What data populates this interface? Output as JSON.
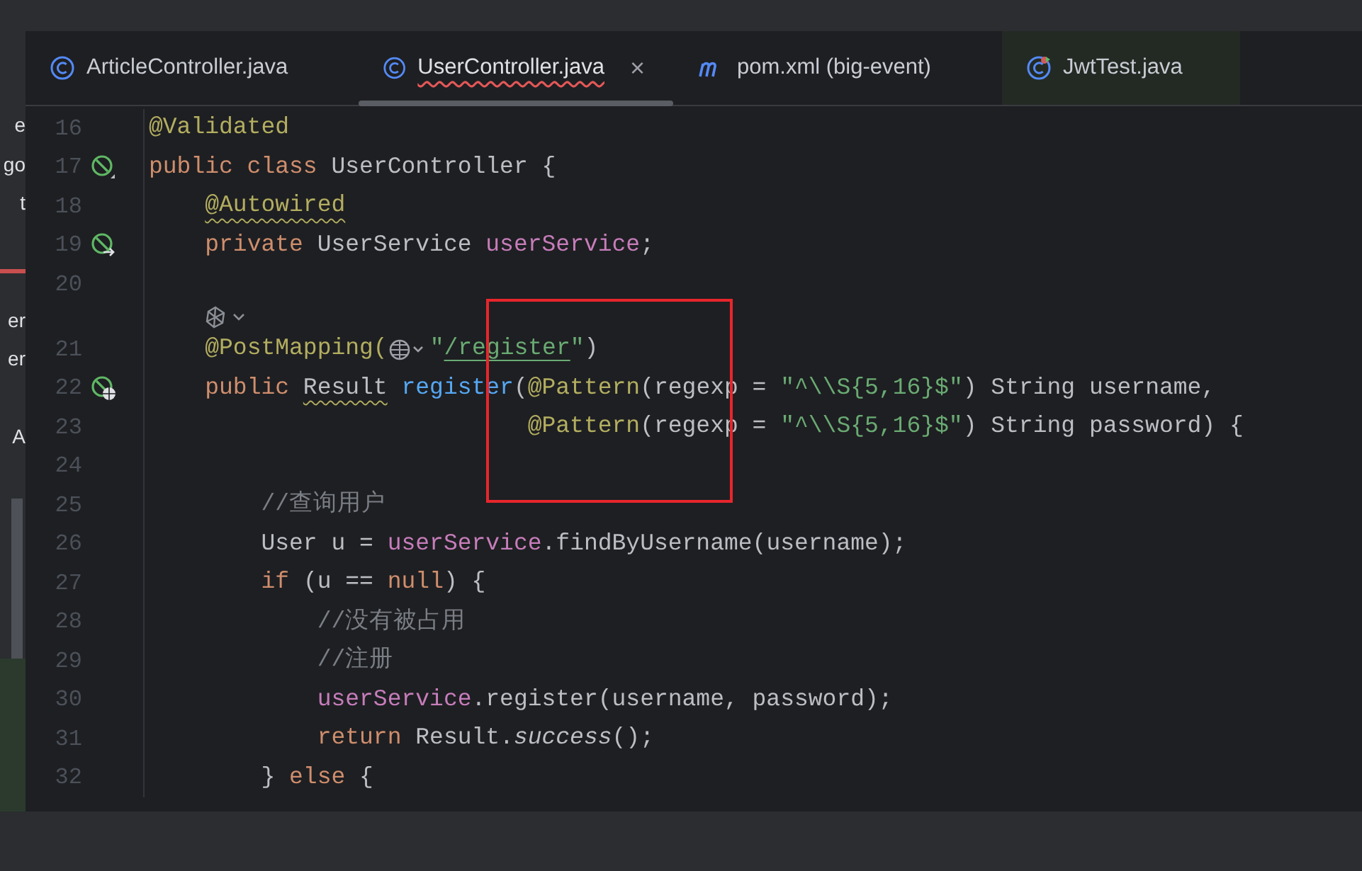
{
  "project_panel": {
    "fragments": [
      "e",
      "go",
      "t",
      "er",
      "er",
      "A"
    ]
  },
  "tabs": [
    {
      "label": "ArticleController.java",
      "kind": "class",
      "selected": false,
      "error": false
    },
    {
      "label": "UserController.java",
      "kind": "class",
      "selected": true,
      "error": true,
      "close": "×"
    },
    {
      "label": "pom.xml (big-event)",
      "kind": "maven",
      "selected": false,
      "error": false
    },
    {
      "label": "JwtTest.java",
      "kind": "test",
      "selected": false,
      "error": false,
      "color": "#232a24"
    }
  ],
  "editor": {
    "lines": [
      {
        "kind": "code",
        "number": "16",
        "tokens": [
          {
            "kind": "annotation",
            "s": "@Validated"
          }
        ]
      },
      {
        "kind": "code",
        "number": "17",
        "gutter": {
          "kind": "bean"
        },
        "tokens": [
          {
            "kind": "keyword",
            "s": "public class "
          },
          {
            "kind": "plain",
            "s": "UserController {"
          }
        ]
      },
      {
        "kind": "code",
        "number": "18",
        "tokens": [
          {
            "kind": "annotation",
            "s": "    @Autowired",
            "wavy": true
          }
        ]
      },
      {
        "kind": "code",
        "number": "19",
        "gutter": {
          "kind": "bean-arrow"
        },
        "tokens": [
          {
            "kind": "keyword",
            "s": "    private "
          },
          {
            "kind": "plain",
            "s": "UserService "
          },
          {
            "kind": "field",
            "s": "userService"
          },
          {
            "kind": "plain",
            "s": ";"
          }
        ]
      },
      {
        "kind": "code",
        "number": "20"
      },
      {
        "kind": "hint"
      },
      {
        "kind": "code",
        "number": "21",
        "tokens": [
          {
            "kind": "annotation",
            "s": "    @PostMapping("
          },
          {
            "kind": "globe"
          },
          {
            "kind": "string",
            "s": "\""
          },
          {
            "kind": "string",
            "s": "/register",
            "link": true
          },
          {
            "kind": "string",
            "s": "\""
          },
          {
            "kind": "plain",
            "s": ")"
          }
        ]
      },
      {
        "kind": "code",
        "number": "22",
        "gutter": {
          "kind": "bean-web"
        },
        "tokens": [
          {
            "kind": "keyword",
            "s": "    public "
          },
          {
            "kind": "plain",
            "s": "Result",
            "wavy": true
          },
          {
            "kind": "method",
            "s": " register"
          },
          {
            "kind": "plain",
            "s": "("
          },
          {
            "kind": "annotation",
            "s": "@Pattern"
          },
          {
            "kind": "plain",
            "s": "(regexp = "
          },
          {
            "kind": "string",
            "s": "\"^\\\\S{5,16}$\""
          },
          {
            "kind": "plain",
            "s": ") String username,"
          }
        ]
      },
      {
        "kind": "code",
        "number": "23",
        "tokens": [
          {
            "kind": "annotation",
            "s": "                           @Pattern"
          },
          {
            "kind": "plain",
            "s": "(regexp = "
          },
          {
            "kind": "string",
            "s": "\"^\\\\S{5,16}$\""
          },
          {
            "kind": "plain",
            "s": ") String password) {"
          }
        ]
      },
      {
        "kind": "code",
        "number": "24"
      },
      {
        "kind": "code",
        "number": "25",
        "tokens": [
          {
            "kind": "comment",
            "s": "        //查询用户"
          }
        ]
      },
      {
        "kind": "code",
        "number": "26",
        "tokens": [
          {
            "kind": "plain",
            "s": "        User u = "
          },
          {
            "kind": "field",
            "s": "userService"
          },
          {
            "kind": "plain",
            "s": ".findByUsername(username);"
          }
        ]
      },
      {
        "kind": "code",
        "number": "27",
        "tokens": [
          {
            "kind": "keyword",
            "s": "        if "
          },
          {
            "kind": "plain",
            "s": "(u == "
          },
          {
            "kind": "keyword",
            "s": "null"
          },
          {
            "kind": "plain",
            "s": ") {"
          }
        ]
      },
      {
        "kind": "code",
        "number": "28",
        "tokens": [
          {
            "kind": "comment",
            "s": "            //没有被占用"
          }
        ]
      },
      {
        "kind": "code",
        "number": "29",
        "tokens": [
          {
            "kind": "comment",
            "s": "            //注册"
          }
        ]
      },
      {
        "kind": "code",
        "number": "30",
        "tokens": [
          {
            "kind": "field",
            "s": "            userService"
          },
          {
            "kind": "plain",
            "s": ".register(username, password);"
          }
        ]
      },
      {
        "kind": "code",
        "number": "31",
        "tokens": [
          {
            "kind": "keyword",
            "s": "            return "
          },
          {
            "kind": "plain",
            "s": "Result."
          },
          {
            "kind": "italic",
            "s": "success"
          },
          {
            "kind": "plain",
            "s": "();"
          }
        ]
      },
      {
        "kind": "code",
        "number": "32",
        "tokens": [
          {
            "kind": "plain",
            "s": "        } "
          },
          {
            "kind": "keyword",
            "s": "else "
          },
          {
            "kind": "plain",
            "s": "{"
          }
        ]
      }
    ]
  }
}
